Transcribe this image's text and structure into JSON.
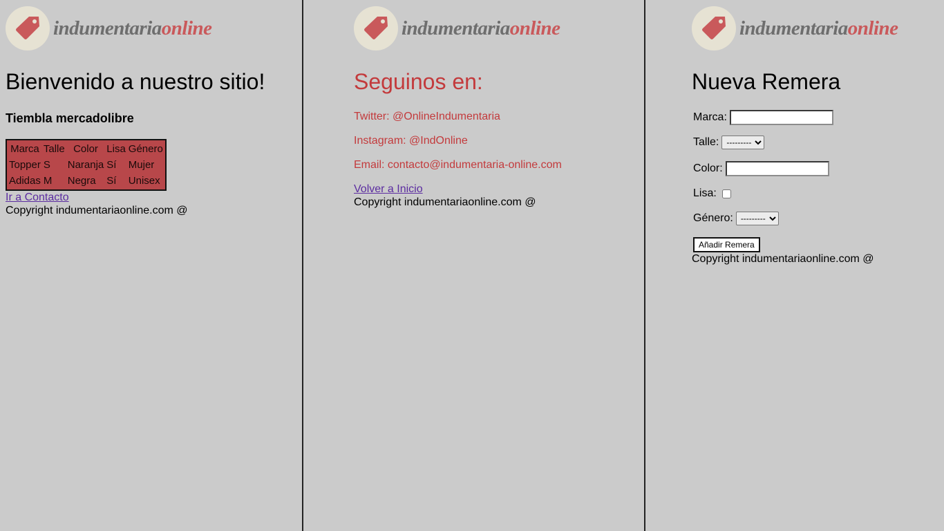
{
  "logo": {
    "text_part1": "indumentaria",
    "text_part2": "online",
    "icon": "tag-icon"
  },
  "colors": {
    "background": "#cbcbcb",
    "accent_red": "#c33a3c",
    "table_bg": "#b8474a",
    "logo_grey": "#6e6e6e",
    "logo_red": "#c9595b"
  },
  "home": {
    "title": "Bienvenido a nuestro sitio!",
    "subtitle": "Tiembla mercadolibre",
    "table": {
      "headers": [
        "Marca",
        "Talle",
        "Color",
        "Lisa",
        "Género"
      ],
      "rows": [
        [
          "Topper",
          "S",
          "Naranja",
          "Sí",
          "Mujer"
        ],
        [
          "Adidas",
          "M",
          "Negra",
          "Sí",
          "Unisex"
        ]
      ]
    },
    "link": "Ir a Contacto",
    "footer": "Copyright indumentariaonline.com @"
  },
  "contact": {
    "title": "Seguinos en:",
    "twitter": "Twitter: @OnlineIndumentaria",
    "instagram": "Instagram: @IndOnline",
    "email": "Email: contacto@indumentaria-online.com",
    "link": "Volver a Inicio",
    "footer": "Copyright indumentariaonline.com @"
  },
  "form": {
    "title": "Nueva Remera",
    "marca_label": "Marca:",
    "marca_value": "",
    "talle_label": "Talle:",
    "talle_selected": "---------",
    "color_label": "Color:",
    "color_value": "",
    "lisa_label": "Lisa:",
    "genero_label": "Género:",
    "genero_selected": "---------",
    "submit_label": "Añadir Remera",
    "footer": "Copyright indumentariaonline.com @"
  }
}
